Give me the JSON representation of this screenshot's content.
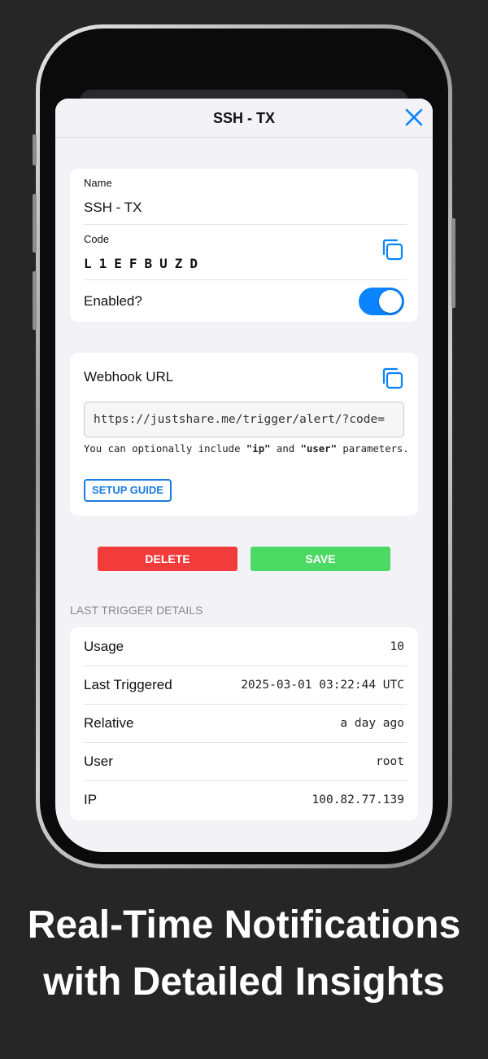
{
  "navbar": {
    "title": "SSH - TX",
    "close_icon": "close-icon"
  },
  "trigger": {
    "name_label": "Name",
    "name_value": "SSH - TX",
    "code_label": "Code",
    "code_value": "L1EFBUZD",
    "enabled_label": "Enabled?",
    "enabled": true,
    "copy_icon": "copy-icon"
  },
  "webhook": {
    "label": "Webhook URL",
    "url": "https://justshare.me/trigger/alert/?code=",
    "hint_prefix": "You can optionally include ",
    "hint_ip": "\"ip\"",
    "hint_and": " and ",
    "hint_user": "\"user\"",
    "hint_suffix": " parameters.",
    "setup_guide": "SETUP GUIDE"
  },
  "actions": {
    "delete": "DELETE",
    "save": "SAVE"
  },
  "colors": {
    "accent": "#0a84ff",
    "delete": "#f23b3b",
    "save": "#4cd964"
  },
  "last_trigger": {
    "header": "LAST TRIGGER DETAILS",
    "rows": [
      {
        "label": "Usage",
        "value": "10"
      },
      {
        "label": "Last Triggered",
        "value": "2025-03-01 03:22:44 UTC"
      },
      {
        "label": "Relative",
        "value": "a day ago"
      },
      {
        "label": "User",
        "value": "root"
      },
      {
        "label": "IP",
        "value": "100.82.77.139"
      }
    ]
  },
  "caption": {
    "line1": "Real-Time Notifications",
    "line2": "with Detailed Insights"
  }
}
